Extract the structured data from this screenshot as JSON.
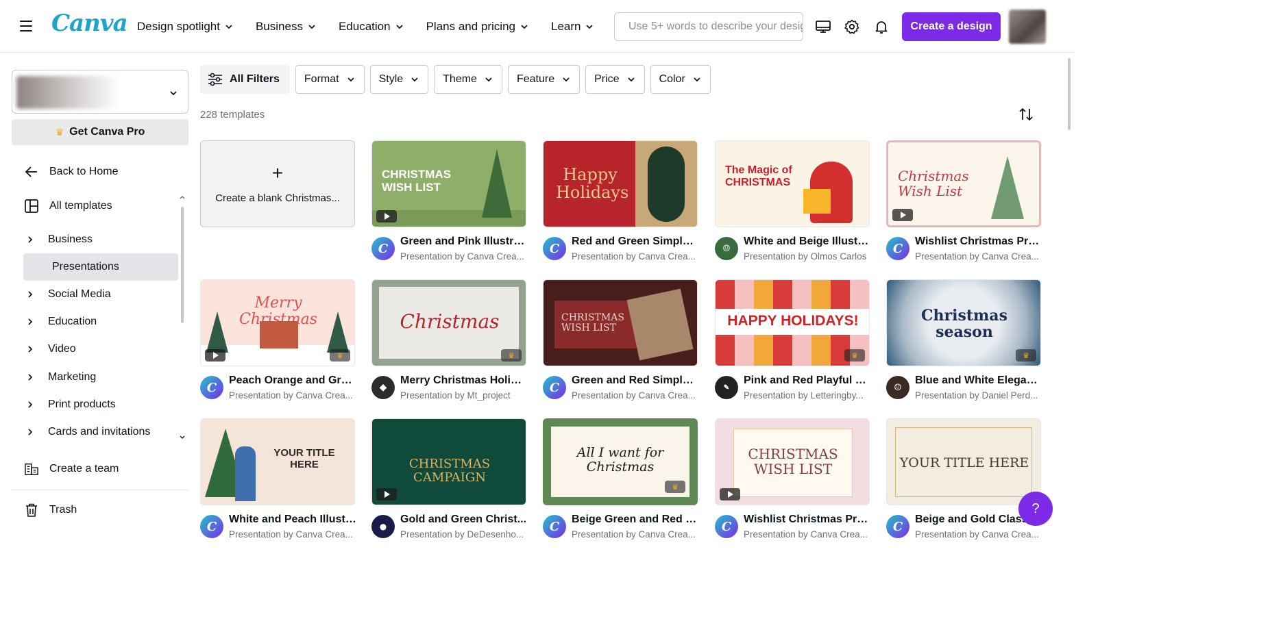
{
  "header": {
    "logo": "Canva",
    "nav": [
      "Design spotlight",
      "Business",
      "Education",
      "Plans and pricing",
      "Learn"
    ],
    "search_placeholder": "Use 5+ words to describe your design",
    "create_label": "Create a design"
  },
  "sidebar": {
    "get_pro": "Get Canva Pro",
    "back_home": "Back to Home",
    "all_templates": "All templates",
    "items": [
      "Business",
      "Presentations",
      "Social Media",
      "Education",
      "Video",
      "Marketing",
      "Print products",
      "Cards and invitations"
    ],
    "create_team": "Create a team",
    "trash": "Trash"
  },
  "filters": {
    "all": "All Filters",
    "items": [
      "Format",
      "Style",
      "Theme",
      "Feature",
      "Price",
      "Color"
    ]
  },
  "count": "228 templates",
  "blank_label": "Create a blank Christmas...",
  "templates": [
    {
      "title": "Green and Pink Illustrat...",
      "by": "Presentation by Canva Crea...",
      "thumb": "CHRISTMAS WISH LIST"
    },
    {
      "title": "Red and Green Simple a...",
      "by": "Presentation by Canva Crea...",
      "thumb": "Happy Holidays"
    },
    {
      "title": "White and Beige Illustra...",
      "by": "Presentation by Olmos Carlos",
      "thumb": "The Magic of CHRISTMAS"
    },
    {
      "title": "Wishlist Christmas Pres...",
      "by": "Presentation by Canva Crea...",
      "thumb": "Christmas Wish List"
    },
    {
      "title": "Peach Orange and Gree...",
      "by": "Presentation by Canva Crea...",
      "thumb": "Merry Christmas"
    },
    {
      "title": "Merry Christmas Holida...",
      "by": "Presentation by Mt_project",
      "thumb": "Christmas"
    },
    {
      "title": "Green and Red Simple a...",
      "by": "Presentation by Canva Crea...",
      "thumb": "CHRISTMAS WISH LIST"
    },
    {
      "title": "Pink and Red Playful Ha...",
      "by": "Presentation by Letteringby...",
      "thumb": "HAPPY HOLIDAYS!"
    },
    {
      "title": "Blue and White Elegant ...",
      "by": "Presentation by Daniel Perd...",
      "thumb": "Christmas season"
    },
    {
      "title": "White and Peach Illustr...",
      "by": "Presentation by Canva Crea...",
      "thumb": "YOUR TITLE HERE"
    },
    {
      "title": "Gold and Green Christ...",
      "by": "Presentation by DeDesenho...",
      "thumb": "CHRISTMAS CAMPAIGN"
    },
    {
      "title": "Beige Green and Red H...",
      "by": "Presentation by Canva Crea...",
      "thumb": "All I want for Christmas"
    },
    {
      "title": "Wishlist Christmas Pres...",
      "by": "Presentation by Canva Crea...",
      "thumb": "CHRISTMAS WISH LIST"
    },
    {
      "title": "Beige and Gold Classy ...",
      "by": "Presentation by Canva Crea...",
      "thumb": "YOUR TITLE HERE"
    }
  ],
  "help": "?"
}
